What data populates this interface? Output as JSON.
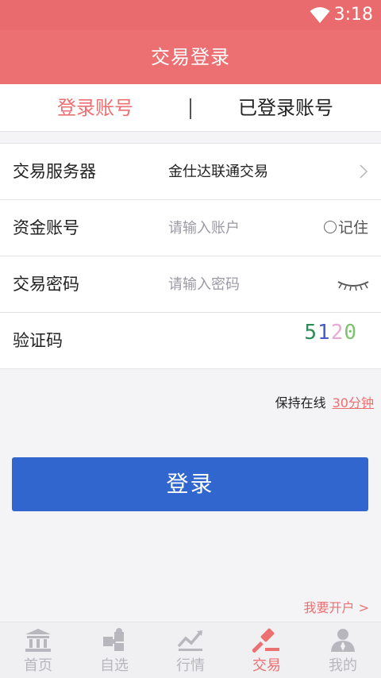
{
  "status_bar": {
    "time": "3:18"
  },
  "header": {
    "title": "交易登录"
  },
  "tabs": [
    {
      "label": "登录账号",
      "active": true
    },
    {
      "label": "已登录账号",
      "active": false
    }
  ],
  "form": {
    "server": {
      "label": "交易服务器",
      "value": "金仕达联通交易"
    },
    "account": {
      "label": "资金账号",
      "placeholder": "请输入账户",
      "remember_label": "记住"
    },
    "password": {
      "label": "交易密码",
      "placeholder": "请输入密码"
    },
    "captcha": {
      "label": "验证码",
      "digits": [
        {
          "char": "5",
          "color": "#2e8b57"
        },
        {
          "char": "1",
          "color": "#4a5cc8"
        },
        {
          "char": "2",
          "color": "#e8a9d6"
        },
        {
          "char": "0",
          "color": "#7cc36b"
        }
      ]
    }
  },
  "keep_online": {
    "label": "保持在线",
    "duration": "30分钟"
  },
  "login_button": {
    "label": "登录"
  },
  "open_account": {
    "label": "我要开户 >"
  },
  "bottom_nav": [
    {
      "label": "首页",
      "icon": "bank-icon",
      "active": false
    },
    {
      "label": "自选",
      "icon": "puzzle-icon",
      "active": false
    },
    {
      "label": "行情",
      "icon": "trend-chart-icon",
      "active": false
    },
    {
      "label": "交易",
      "icon": "gavel-icon",
      "active": true
    },
    {
      "label": "我的",
      "icon": "user-icon",
      "active": false
    }
  ],
  "colors": {
    "brand": "#ec6f71",
    "primary_button": "#3166cf",
    "inactive_nav": "#b7b7bd"
  }
}
